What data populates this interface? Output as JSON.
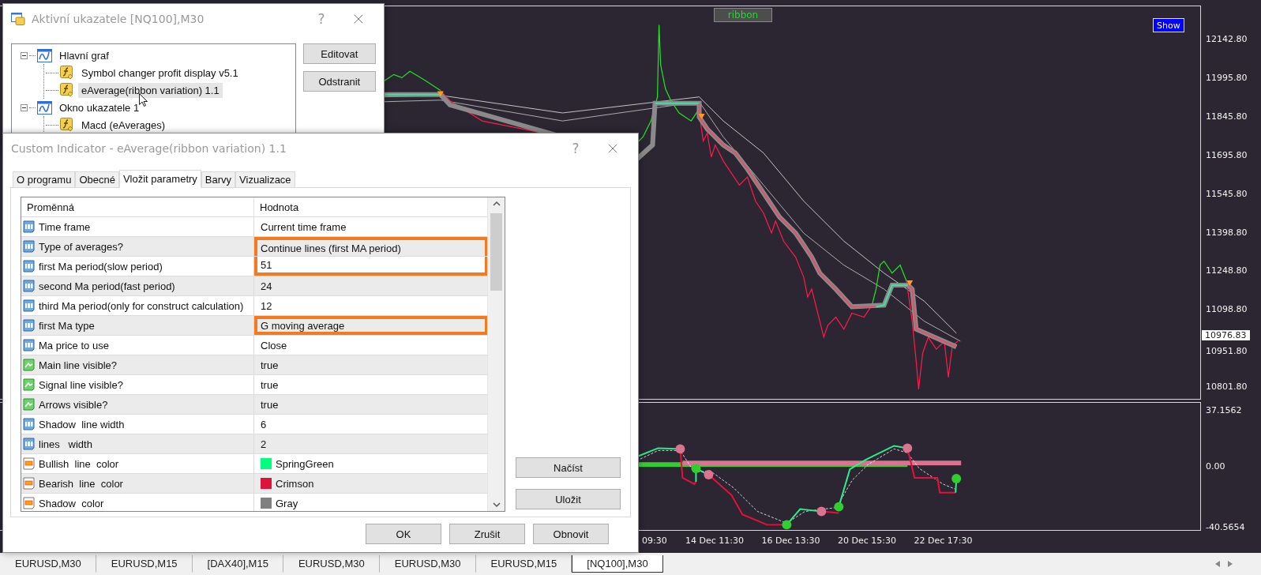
{
  "chart": {
    "indicator_label": "ribbon",
    "show_button": "Show",
    "price_axis": [
      "12142.80",
      "11995.80",
      "11845.80",
      "11695.80",
      "11545.80",
      "11398.80",
      "11248.80",
      "11098.80",
      "10951.80",
      "10801.80"
    ],
    "current_price": "10976.83",
    "indicator_axis": [
      "37.1562",
      "0.00",
      "-40.5654"
    ],
    "time_axis": [
      "09:30",
      "14 Dec 11:30",
      "16 Dec 13:30",
      "20 Dec 15:30",
      "22 Dec 17:30"
    ]
  },
  "symbol_tabs": [
    {
      "label": "EURUSD,M30",
      "selected": false
    },
    {
      "label": "EURUSD,M15",
      "selected": false
    },
    {
      "label": "[DAX40],M15",
      "selected": false
    },
    {
      "label": "EURUSD,M30",
      "selected": false
    },
    {
      "label": "EURUSD,M30",
      "selected": false
    },
    {
      "label": "EURUSD,M15",
      "selected": false
    },
    {
      "label": "[NQ100],M30",
      "selected": true
    }
  ],
  "indicators_dialog": {
    "title": "Aktivní ukazatele [NQ100],M30",
    "help": "?",
    "tree": [
      {
        "label": "Hlavní graf",
        "kind": "window",
        "expanded": true,
        "selected": false,
        "children": [
          {
            "label": "Symbol changer profit display v5.1",
            "kind": "indicator",
            "selected": false
          },
          {
            "label": "eAverage(ribbon variation) 1.1",
            "kind": "indicator",
            "selected": true
          }
        ]
      },
      {
        "label": "Okno ukazatele 1",
        "kind": "window",
        "expanded": true,
        "selected": false,
        "children": [
          {
            "label": "Macd (eAverages)",
            "kind": "indicator",
            "selected": false
          }
        ]
      }
    ],
    "buttons": [
      "Editovat",
      "Odstranit"
    ]
  },
  "indicator_dialog": {
    "title": "Custom Indicator - eAverage(ribbon variation) 1.1",
    "help": "?",
    "tabs": [
      {
        "label": "O programu",
        "selected": false
      },
      {
        "label": "Obecné",
        "selected": false
      },
      {
        "label": "Vložit parametry",
        "selected": true
      },
      {
        "label": "Barvy",
        "selected": false
      },
      {
        "label": "Vizualizace",
        "selected": false
      }
    ],
    "columns": [
      "Proměnná",
      "Hodnota"
    ],
    "params": [
      {
        "kind": "number",
        "name": "Time frame",
        "value": "Current time frame",
        "highlighted": false
      },
      {
        "kind": "number",
        "name": "Type of averages?",
        "value": "Continue lines (first MA period)",
        "highlighted": true
      },
      {
        "kind": "number",
        "name": "first Ma period(slow period)",
        "value": "51",
        "highlighted": true
      },
      {
        "kind": "number",
        "name": "second Ma period(fast period)",
        "value": "24",
        "highlighted": false
      },
      {
        "kind": "number",
        "name": "third Ma period(only for construct calculation)",
        "value": "12",
        "highlighted": false
      },
      {
        "kind": "number",
        "name": "first Ma type",
        "value": "G moving average",
        "highlighted": true
      },
      {
        "kind": "number",
        "name": "Ma price to use",
        "value": "Close",
        "highlighted": false
      },
      {
        "kind": "bool",
        "name": "Main line visible?",
        "value": "true",
        "highlighted": false
      },
      {
        "kind": "bool",
        "name": "Signal line visible?",
        "value": "true",
        "highlighted": false
      },
      {
        "kind": "bool",
        "name": "Arrows visible?",
        "value": "true",
        "highlighted": false
      },
      {
        "kind": "number",
        "name": "Shadow  line width",
        "value": "6",
        "highlighted": false
      },
      {
        "kind": "number",
        "name": "lines   width",
        "value": "2",
        "highlighted": false
      },
      {
        "kind": "color",
        "name": "Bullish  line  color",
        "value": "SpringGreen",
        "color": "#00ff7f",
        "highlighted": false
      },
      {
        "kind": "color",
        "name": "Bearish  line  color",
        "value": "Crimson",
        "color": "#dc143c",
        "highlighted": false
      },
      {
        "kind": "color",
        "name": "Shadow  color",
        "value": "Gray",
        "color": "#808080",
        "highlighted": false
      }
    ],
    "side_buttons": [
      "Načíst",
      "Uložit"
    ],
    "buttons": [
      "OK",
      "Zrušit",
      "Obnovit"
    ]
  }
}
